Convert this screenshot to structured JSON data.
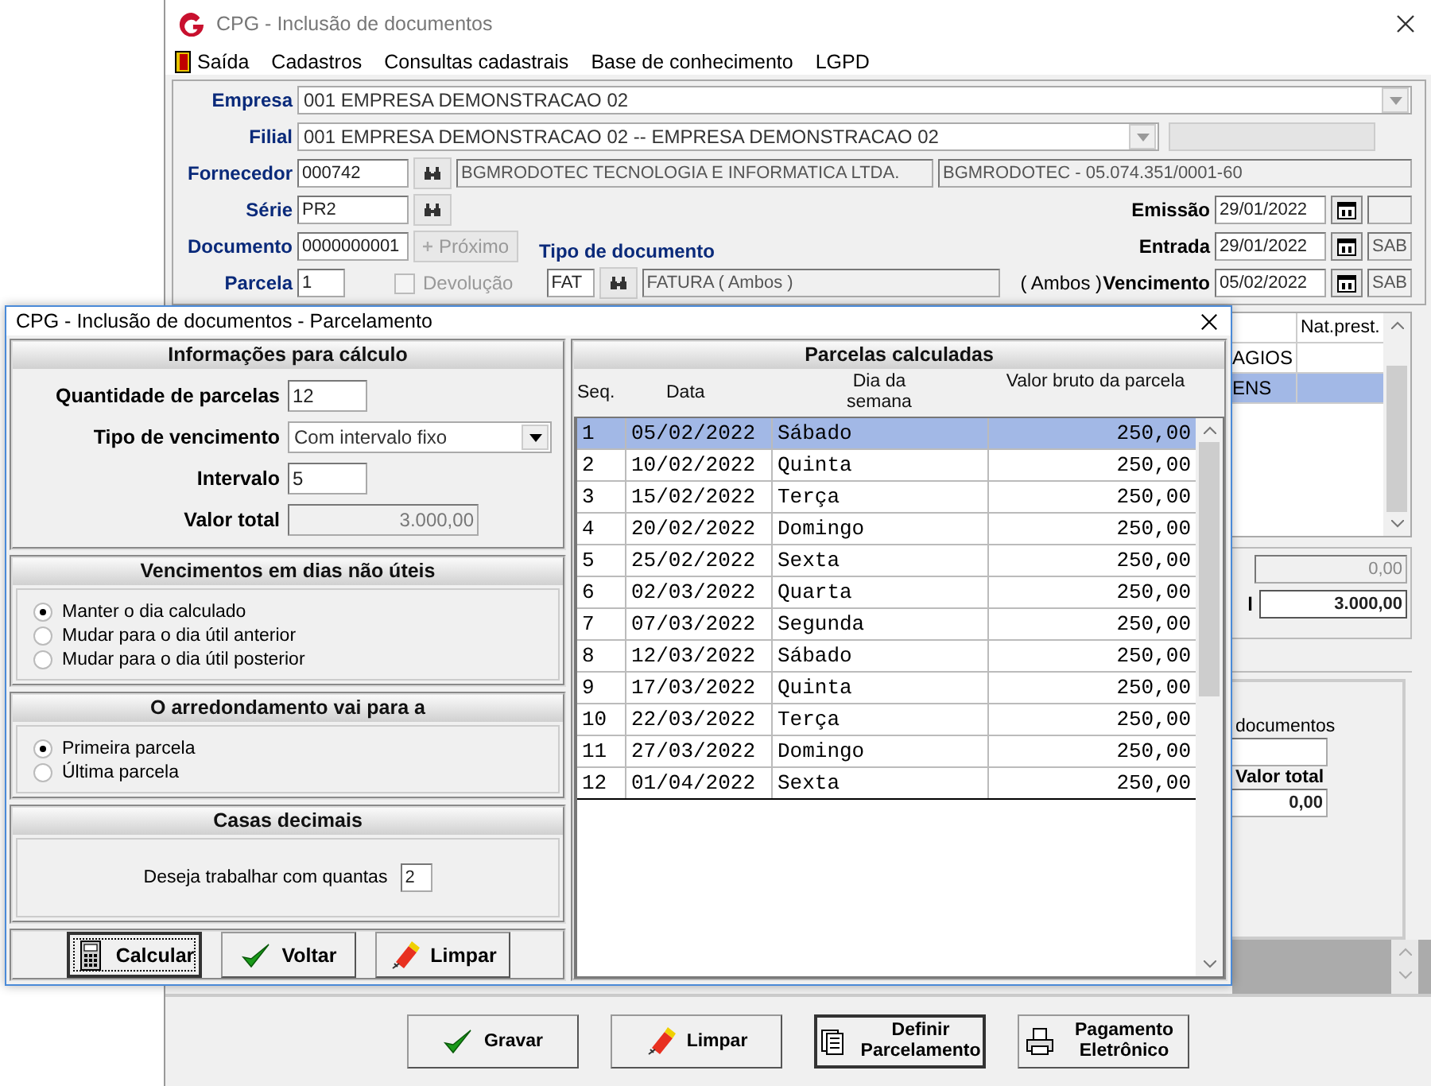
{
  "window": {
    "title": "CPG - Inclusão de documentos"
  },
  "menu": [
    "Saída",
    "Cadastros",
    "Consultas cadastrais",
    "Base de conhecimento",
    "LGPD"
  ],
  "form": {
    "empresa": {
      "label": "Empresa",
      "value": "001 EMPRESA DEMONSTRACAO 02"
    },
    "filial": {
      "label": "Filial",
      "value": "001 EMPRESA DEMONSTRACAO 02 -- EMPRESA DEMONSTRACAO 02"
    },
    "fornecedor": {
      "label": "Fornecedor",
      "code": "000742",
      "name": "BGMRODOTEC TECNOLOGIA E INFORMATICA LTDA.",
      "alias": "BGMRODOTEC - 05.074.351/0001-60"
    },
    "serie": {
      "label": "Série",
      "value": "PR2"
    },
    "documento": {
      "label": "Documento",
      "value": "0000000001",
      "next_label": "Próximo",
      "next_disabled": true
    },
    "parcela": {
      "label": "Parcela",
      "value": "1"
    },
    "devolucao": {
      "label": "Devolução",
      "checked": false,
      "disabled": true
    },
    "tipo_documento": {
      "label": "Tipo de documento",
      "code": "FAT",
      "name": "FATURA ( Ambos )",
      "note": "( Ambos )"
    },
    "dates": [
      {
        "label": "Emissão",
        "value": "29/01/2022"
      },
      {
        "label": "Entrada",
        "value": "29/01/2022",
        "day": "SAB"
      },
      {
        "label": "Vencimento",
        "value": "05/02/2022",
        "day": "SAB"
      }
    ]
  },
  "background_grid": {
    "column": "Nat.prest.",
    "rows": [
      {
        "cell": "AGIOS",
        "selected": false
      },
      {
        "cell": "ENS",
        "selected": true
      }
    ]
  },
  "background_totals": {
    "value_1": "0,00",
    "label_2": "l",
    "value_2": "3.000,00"
  },
  "background_summary": {
    "label": "documentos",
    "total_label": "Valor total",
    "total_value": "0,00"
  },
  "buttons": [
    {
      "label": "Gravar",
      "kind": "check",
      "focused": false
    },
    {
      "label": "Limpar",
      "kind": "eraser",
      "focused": false
    },
    {
      "label": "Definir Parcelamento",
      "kind": "pages",
      "focused": true
    },
    {
      "label": "Pagamento Eletrônico",
      "kind": "printer",
      "focused": false
    }
  ],
  "dialog": {
    "title": "CPG - Inclusão de documentos - Parcelamento",
    "calc": {
      "title": "Informações para cálculo",
      "fields": [
        {
          "label": "Quantidade de parcelas",
          "value": "12",
          "kind": "input"
        },
        {
          "label": "Tipo de vencimento",
          "value": "Com intervalo fixo",
          "kind": "select"
        },
        {
          "label": "Intervalo",
          "value": "5",
          "kind": "input"
        },
        {
          "label": "Valor total",
          "value": "3.000,00",
          "kind": "readonly"
        }
      ]
    },
    "nonbusiness": {
      "title": "Vencimentos em dias não úteis",
      "options": [
        {
          "label": "Manter o dia calculado",
          "selected": true
        },
        {
          "label": "Mudar para o dia útil anterior",
          "selected": false
        },
        {
          "label": "Mudar para o dia útil posterior",
          "selected": false
        }
      ]
    },
    "rounding": {
      "title": "O arredondamento vai para a",
      "options": [
        {
          "label": "Primeira parcela",
          "selected": true
        },
        {
          "label": "Última parcela",
          "selected": false
        }
      ]
    },
    "decimals": {
      "title": "Casas decimais",
      "label": "Deseja trabalhar com quantas",
      "value": "2"
    },
    "actions": [
      {
        "label": "Calcular",
        "kind": "calculator",
        "focused": true
      },
      {
        "label": "Voltar",
        "kind": "check",
        "focused": false
      },
      {
        "label": "Limpar",
        "kind": "eraser",
        "focused": false
      }
    ],
    "results": {
      "title": "Parcelas calculadas",
      "columns": [
        "Seq.",
        "Data",
        "Dia da semana",
        "Valor bruto da parcela"
      ],
      "rows": [
        {
          "seq": "1",
          "date": "05/02/2022",
          "weekday": "Sábado",
          "value": "250,00",
          "selected": true
        },
        {
          "seq": "2",
          "date": "10/02/2022",
          "weekday": "Quinta",
          "value": "250,00",
          "selected": false
        },
        {
          "seq": "3",
          "date": "15/02/2022",
          "weekday": "Terça",
          "value": "250,00",
          "selected": false
        },
        {
          "seq": "4",
          "date": "20/02/2022",
          "weekday": "Domingo",
          "value": "250,00",
          "selected": false
        },
        {
          "seq": "5",
          "date": "25/02/2022",
          "weekday": "Sexta",
          "value": "250,00",
          "selected": false
        },
        {
          "seq": "6",
          "date": "02/03/2022",
          "weekday": "Quarta",
          "value": "250,00",
          "selected": false
        },
        {
          "seq": "7",
          "date": "07/03/2022",
          "weekday": "Segunda",
          "value": "250,00",
          "selected": false
        },
        {
          "seq": "8",
          "date": "12/03/2022",
          "weekday": "Sábado",
          "value": "250,00",
          "selected": false
        },
        {
          "seq": "9",
          "date": "17/03/2022",
          "weekday": "Quinta",
          "value": "250,00",
          "selected": false
        },
        {
          "seq": "10",
          "date": "22/03/2022",
          "weekday": "Terça",
          "value": "250,00",
          "selected": false
        },
        {
          "seq": "11",
          "date": "27/03/2022",
          "weekday": "Domingo",
          "value": "250,00",
          "selected": false
        },
        {
          "seq": "12",
          "date": "01/04/2022",
          "weekday": "Sexta",
          "value": "250,00",
          "selected": false
        }
      ]
    }
  }
}
